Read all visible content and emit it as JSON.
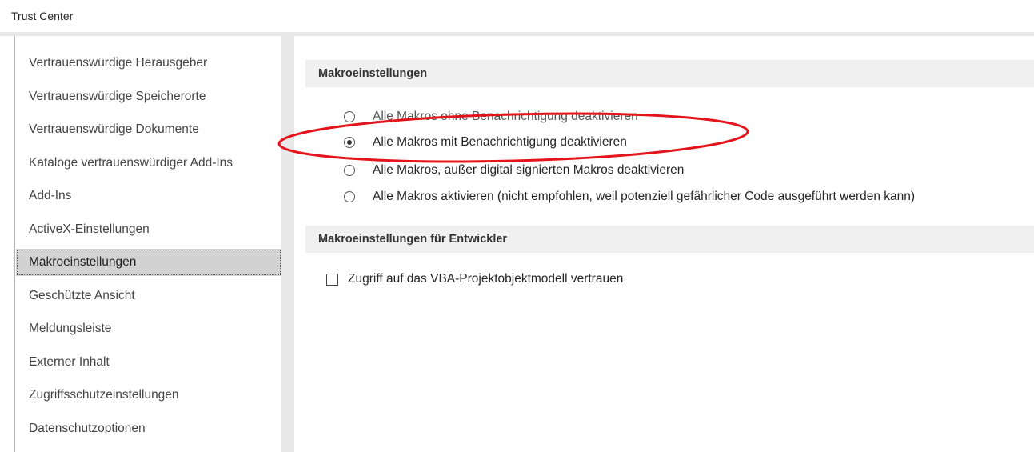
{
  "window": {
    "title": "Trust Center"
  },
  "sidebar": {
    "items": [
      {
        "label": "Vertrauenswürdige Herausgeber",
        "selected": false
      },
      {
        "label": "Vertrauenswürdige Speicherorte",
        "selected": false
      },
      {
        "label": "Vertrauenswürdige Dokumente",
        "selected": false
      },
      {
        "label": "Kataloge vertrauenswürdiger Add-Ins",
        "selected": false
      },
      {
        "label": "Add-Ins",
        "selected": false
      },
      {
        "label": "ActiveX-Einstellungen",
        "selected": false
      },
      {
        "label": "Makroeinstellungen",
        "selected": true
      },
      {
        "label": "Geschützte Ansicht",
        "selected": false
      },
      {
        "label": "Meldungsleiste",
        "selected": false
      },
      {
        "label": "Externer Inhalt",
        "selected": false
      },
      {
        "label": "Zugriffsschutzeinstellungen",
        "selected": false
      },
      {
        "label": "Datenschutzoptionen",
        "selected": false
      }
    ]
  },
  "macro_settings": {
    "header": "Makroeinstellungen",
    "options": [
      {
        "label": "Alle Makros ohne Benachrichtigung deaktivieren",
        "checked": false
      },
      {
        "label": "Alle Makros mit Benachrichtigung deaktivieren",
        "checked": true
      },
      {
        "label": "Alle Makros, außer digital signierten Makros deaktivieren",
        "checked": false
      },
      {
        "label": "Alle Makros aktivieren (nicht empfohlen, weil potenziell gefährlicher Code ausgeführt werden kann)",
        "checked": false
      }
    ]
  },
  "developer_settings": {
    "header": "Makroeinstellungen für Entwickler",
    "vba_access_label": "Zugriff auf das VBA-Projektobjektmodell vertrauen",
    "vba_access_checked": false
  },
  "annotation": {
    "color": "#e3141b"
  }
}
